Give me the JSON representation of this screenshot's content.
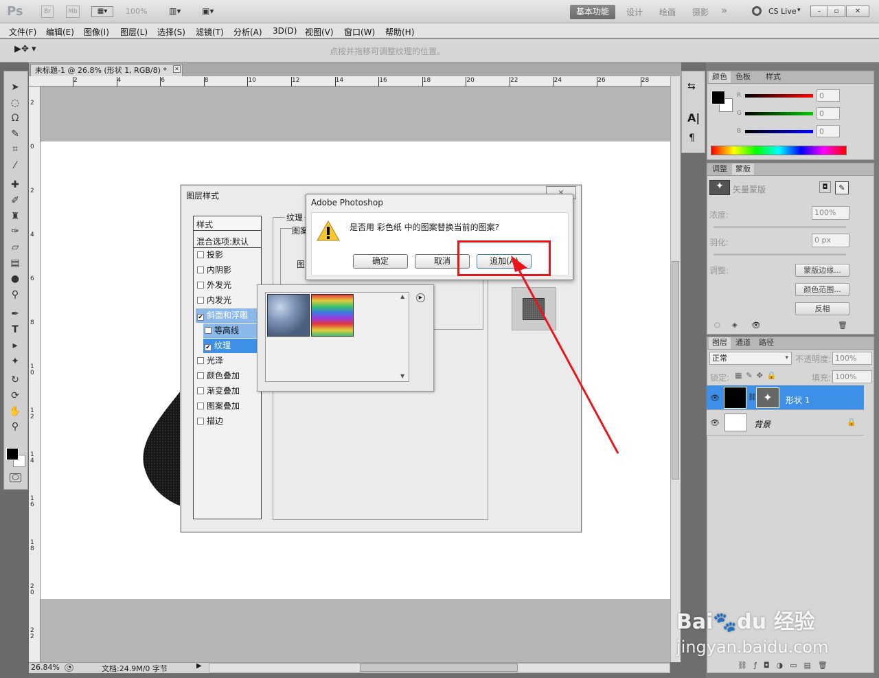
{
  "app": {
    "logo": "Ps",
    "btn_br": "Br",
    "btn_mb": "Mb",
    "zoom": "100%",
    "cs_live": "CS Live",
    "win_min": "–",
    "win_max": "▫",
    "win_close": "✕"
  },
  "workspaces": {
    "active": "基本功能",
    "items": [
      "设计",
      "绘画",
      "摄影"
    ],
    "more": "»"
  },
  "menu": [
    "文件(F)",
    "编辑(E)",
    "图像(I)",
    "图层(L)",
    "选择(S)",
    "滤镜(T)",
    "分析(A)",
    "3D(D)",
    "视图(V)",
    "窗口(W)",
    "帮助(H)"
  ],
  "options": {
    "hint": "点按并拖移可调整纹理的位置。"
  },
  "document": {
    "tab": "未标题-1 @ 26.8% (形状 1, RGB/8) *",
    "close": "✕"
  },
  "ruler_h": [
    "2",
    "4",
    "6",
    "8",
    "10",
    "12",
    "14",
    "16",
    "18",
    "20",
    "22",
    "24",
    "26",
    "28"
  ],
  "ruler_v": [
    "2",
    "0",
    "2",
    "4",
    "6",
    "8",
    "1\n0",
    "1\n2",
    "1\n4",
    "1\n6",
    "1\n8",
    "2\n0",
    "2\n2"
  ],
  "status": {
    "zoom": "26.84%",
    "doc": "文档:24.9M/0 字节"
  },
  "layer_style": {
    "title": "图层样式",
    "close": "✕",
    "list_header": "样式",
    "blend": "混合选项:默认",
    "items": [
      {
        "label": "投影",
        "checked": false
      },
      {
        "label": "内阴影",
        "checked": false
      },
      {
        "label": "外发光",
        "checked": false
      },
      {
        "label": "内发光",
        "checked": false
      },
      {
        "label": "斜面和浮雕",
        "checked": true
      },
      {
        "label": "等高线",
        "checked": false
      },
      {
        "label": "纹理",
        "checked": true
      },
      {
        "label": "光泽",
        "checked": false
      },
      {
        "label": "颜色叠加",
        "checked": false
      },
      {
        "label": "渐变叠加",
        "checked": false
      },
      {
        "label": "图案叠加",
        "checked": false
      },
      {
        "label": "描边",
        "checked": false
      }
    ],
    "texture_group": "纹理",
    "sub_group": "图案",
    "pattern_label": "图"
  },
  "alert": {
    "title": "Adobe Photoshop",
    "message": "是否用 彩色纸 中的图案替换当前的图案?",
    "ok": "确定",
    "cancel": "取消",
    "append": "追加(A)"
  },
  "color_panel": {
    "tabs": [
      "颜色",
      "色板",
      "样式"
    ],
    "r_label": "R",
    "g_label": "G",
    "b_label": "B",
    "r": "0",
    "g": "0",
    "b": "0"
  },
  "masks_panel": {
    "tabs": [
      "调整",
      "蒙版"
    ],
    "title": "矢量蒙版",
    "density_label": "浓度:",
    "density": "100%",
    "feather_label": "羽化:",
    "feather": "0 px",
    "refine_label": "调整:",
    "mask_edge": "蒙版边缘...",
    "color_range": "颜色范围...",
    "invert": "反相"
  },
  "layers_panel": {
    "tabs": [
      "图层",
      "通道",
      "路径"
    ],
    "blend_mode": "正常",
    "opacity_label": "不透明度:",
    "opacity": "100%",
    "lock_label": "锁定:",
    "fill_label": "填充:",
    "fill": "100%",
    "layers": [
      {
        "name": "形状 1",
        "selected": true
      },
      {
        "name": "背景",
        "selected": false
      }
    ]
  },
  "watermark": {
    "brand": "Bai",
    "brand2": "du",
    "brand3": "经验",
    "url": "jingyan.baidu.com"
  }
}
